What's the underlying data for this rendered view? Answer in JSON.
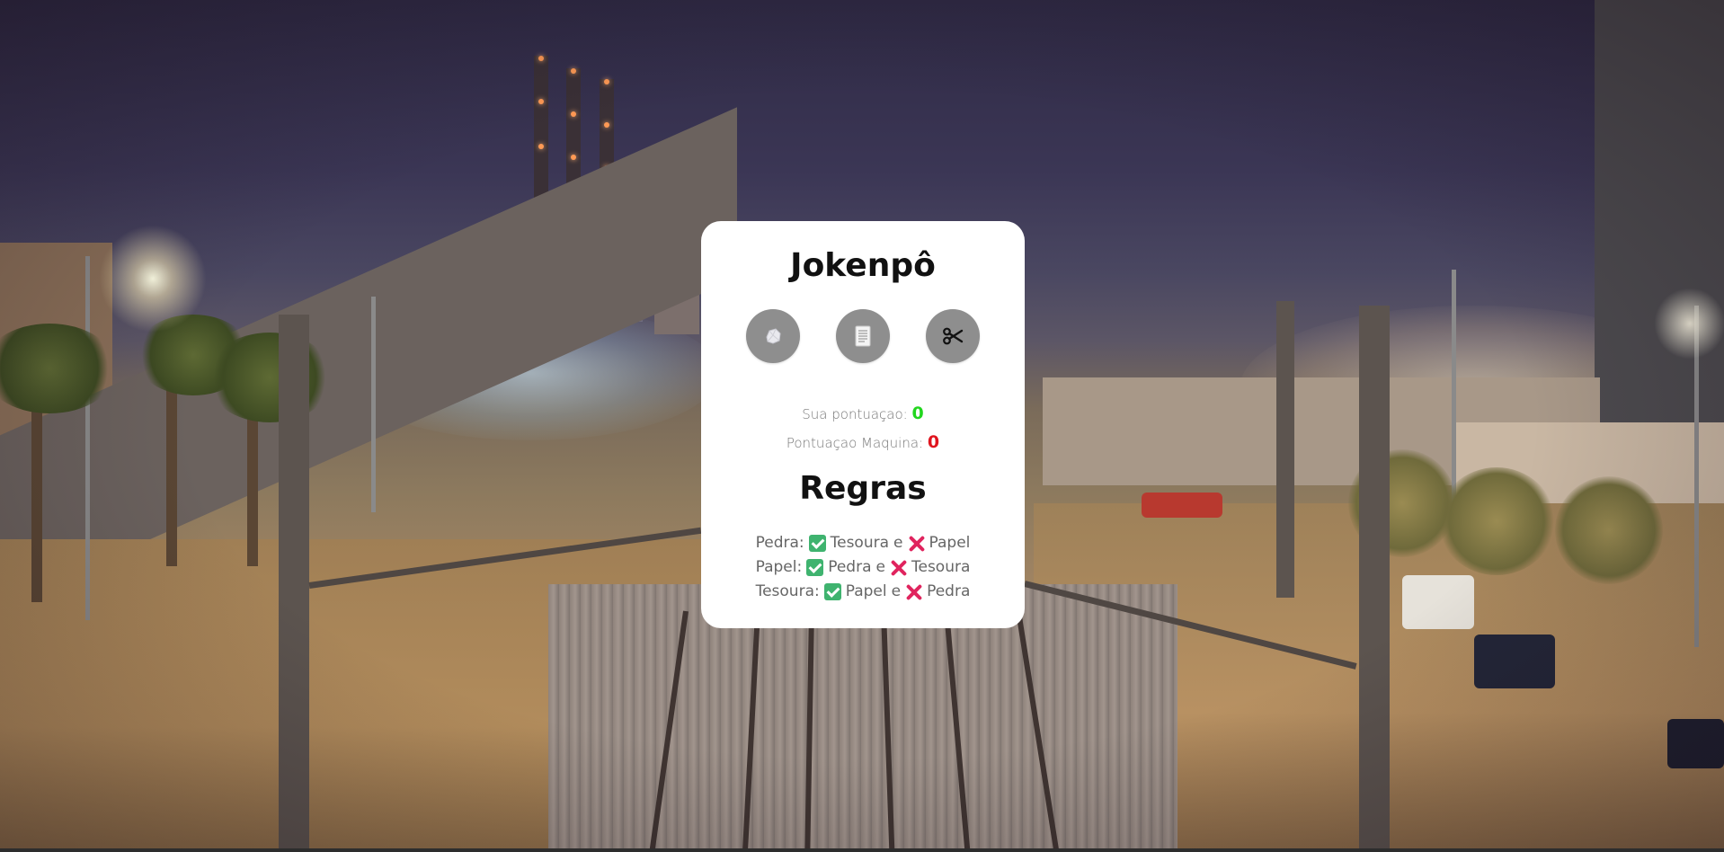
{
  "game": {
    "title": "Jokenpô",
    "choices": [
      {
        "name": "pedra",
        "icon": "rock-icon"
      },
      {
        "name": "papel",
        "icon": "paper-icon"
      },
      {
        "name": "tesoura",
        "icon": "scissors-icon"
      }
    ]
  },
  "score": {
    "player_label": "Sua pontuaçao:",
    "player_value": "0",
    "machine_label": "Pontuaçao Maquina:",
    "machine_value": "0"
  },
  "rules": {
    "title": "Regras",
    "items": [
      {
        "subject": "Pedra:",
        "beats": "Tesoura",
        "connector": "e",
        "loses": "Papel"
      },
      {
        "subject": "Papel:",
        "beats": "Pedra",
        "connector": "e",
        "loses": "Tesoura"
      },
      {
        "subject": "Tesoura:",
        "beats": "Papel",
        "connector": "e",
        "loses": "Pedra"
      }
    ]
  },
  "colors": {
    "card_bg": "#ffffff",
    "choice_button_bg": "#8e8e8e",
    "score_player": "#22d61e",
    "score_machine": "#e0141e",
    "check_mark": "#3fb36f",
    "cross_mark": "#e0245e"
  },
  "background": {
    "description_icon": "night-railway-photo"
  }
}
